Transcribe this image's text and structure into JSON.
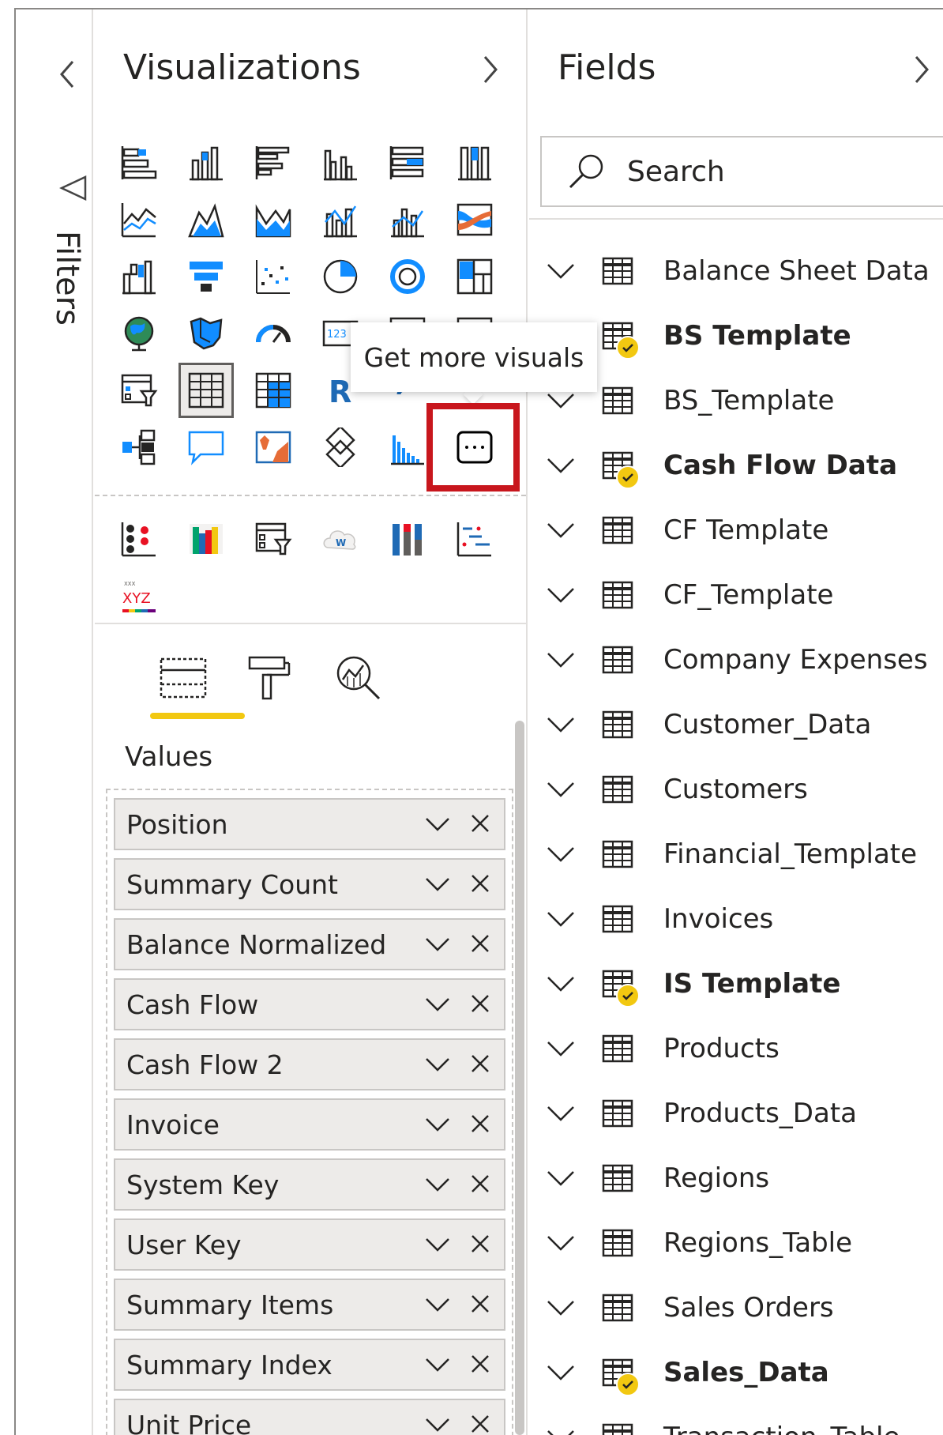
{
  "filters": {
    "label": "Filters"
  },
  "visualizations": {
    "title": "Visualizations",
    "tooltip": "Get more visuals",
    "values_label": "Values",
    "wells": [
      "Position",
      "Summary Count",
      "Balance Normalized",
      "Cash Flow",
      "Cash Flow 2",
      "Invoice",
      "System Key",
      "User Key",
      "Summary Items",
      "Summary Index",
      "Unit Price"
    ]
  },
  "fields": {
    "title": "Fields",
    "search_placeholder": "Search",
    "tables": [
      {
        "name": "Balance Sheet Data",
        "bold": false,
        "badge": false
      },
      {
        "name": "BS Template",
        "bold": true,
        "badge": true
      },
      {
        "name": "BS_Template",
        "bold": false,
        "badge": false
      },
      {
        "name": "Cash Flow Data",
        "bold": true,
        "badge": true
      },
      {
        "name": "CF Template",
        "bold": false,
        "badge": false
      },
      {
        "name": "CF_Template",
        "bold": false,
        "badge": false
      },
      {
        "name": "Company Expenses",
        "bold": false,
        "badge": false
      },
      {
        "name": "Customer_Data",
        "bold": false,
        "badge": false
      },
      {
        "name": "Customers",
        "bold": false,
        "badge": false
      },
      {
        "name": "Financial_Template",
        "bold": false,
        "badge": false
      },
      {
        "name": "Invoices",
        "bold": false,
        "badge": false
      },
      {
        "name": "IS Template",
        "bold": true,
        "badge": true
      },
      {
        "name": "Products",
        "bold": false,
        "badge": false
      },
      {
        "name": "Products_Data",
        "bold": false,
        "badge": false
      },
      {
        "name": "Regions",
        "bold": false,
        "badge": false
      },
      {
        "name": "Regions_Table",
        "bold": false,
        "badge": false
      },
      {
        "name": "Sales Orders",
        "bold": false,
        "badge": false
      },
      {
        "name": "Sales_Data",
        "bold": true,
        "badge": true
      },
      {
        "name": "Transaction_Table",
        "bold": false,
        "badge": false
      }
    ]
  },
  "colors": {
    "accent": "#f2c811",
    "highlight": "#c8161d",
    "icon_blue": "#118dff",
    "icon_dark": "#252423"
  }
}
